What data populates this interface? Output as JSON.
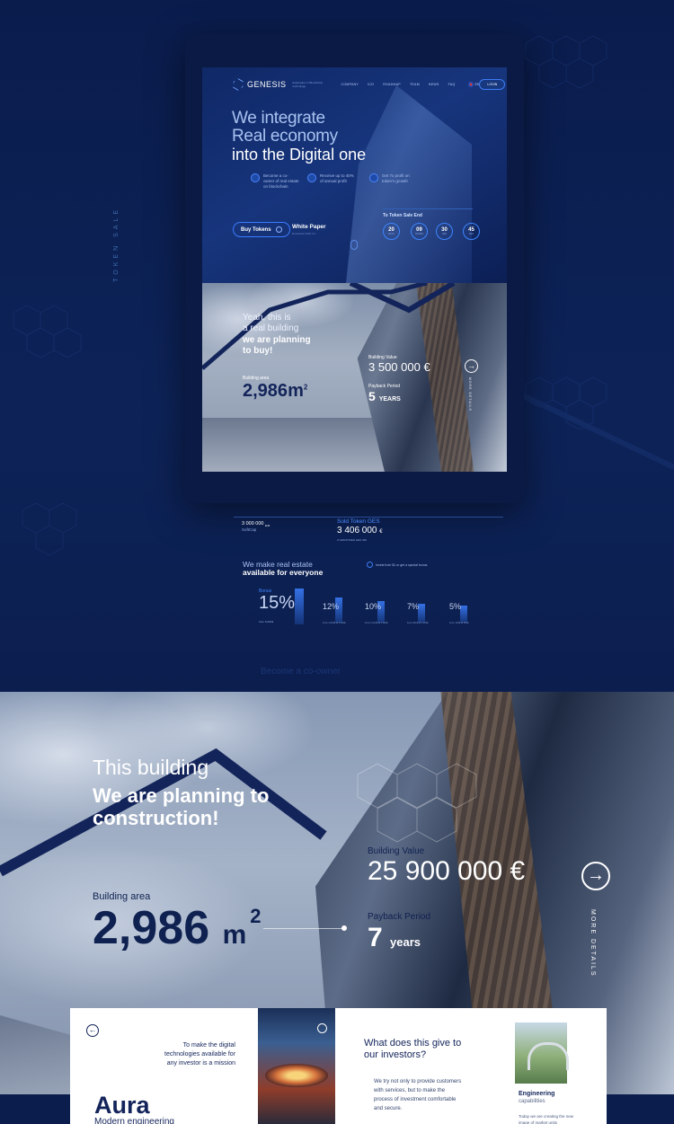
{
  "side_label": "TOKEN SALE",
  "brand": {
    "name": "GENESIS",
    "tagline": "Exploration in Blockchain technology"
  },
  "nav": {
    "items": [
      "COMPANY",
      "ICO",
      "ROADMAP",
      "TEAM",
      "NEWS",
      "FAQ"
    ],
    "lang": "EN",
    "login": "LOGIN"
  },
  "hero": {
    "line1": "We integrate",
    "line2": "Real economy",
    "line3": "into the Digital one",
    "features": [
      {
        "text": "Become a co-owner of real estate on blockchain"
      },
      {
        "text": "Receive up to 40% of annual profit"
      },
      {
        "text": "Get 7x profit on token's growth"
      }
    ],
    "buy_label": "Buy Tokens",
    "white_paper": "White Paper",
    "white_paper_sub": "Download 2018 V.3",
    "token_sale_end": "To Token Sale End",
    "countdown": [
      {
        "value": "20",
        "unit": "DAYS"
      },
      {
        "value": "09",
        "unit": "HOURS"
      },
      {
        "value": "30",
        "unit": "MIN"
      },
      {
        "value": "45",
        "unit": "SEC"
      }
    ]
  },
  "preview_building": {
    "line1": "Yeah, this is",
    "line2": "a real building",
    "line3": "we are planning",
    "line4": "to buy!",
    "area_label": "Building area",
    "area_value": "2,986",
    "area_unit": "m",
    "area_sup": "2",
    "value_label": "Building Value",
    "value": "3 500 000 €",
    "payback_label": "Payback Period",
    "payback_value": "5",
    "payback_unit": "YEARS",
    "more": "MORE DETAILS"
  },
  "sale": {
    "softcap_value": "3 000 000",
    "softcap_unit": "EUR",
    "softcap_label": "SoftCap",
    "sold_label": "Sold Token GES",
    "sold_value": "3 406 000",
    "sold_unit": "€",
    "sold_sub": "2 GES/TOKEN  GES 400",
    "make1": "We make real estate",
    "make2": "available for everyone",
    "invest": "Invest from $1 or get a special bonus",
    "bonus_label": "Bonus",
    "bonus_value": "15%",
    "bonus_from": "from 5,001$",
    "tiers": [
      {
        "pct": "12%",
        "from": "From 2,801$ till 5,000$"
      },
      {
        "pct": "10%",
        "from": "From 2,001$ till 2,800$"
      },
      {
        "pct": "7%",
        "from": "From 801$ till 2,000$"
      },
      {
        "pct": "5%",
        "from": "From 100$ till 800$"
      }
    ],
    "ghost": "Become a co-owner"
  },
  "building": {
    "line1": "This building",
    "line2": "We are planning to",
    "line3": "construction!",
    "value_label": "Building Value",
    "value": "25 900 000 €",
    "area_label": "Building area",
    "area_value": "2,986",
    "area_unit": "m",
    "area_sup": "2",
    "payback_label": "Payback Period",
    "payback_value": "7",
    "payback_unit": "years",
    "more": "MORE DETAILS"
  },
  "cards": {
    "mission": "To make the digital technologies available for any investor is a mission",
    "title": "Aura",
    "subtitle": "Modern engineering",
    "question": "What does this give to our investors?",
    "answer": "We try not only to provide customers with services, but to make the process of investment comfortable and secure.",
    "eng_title": "Engineering",
    "eng_sub": "capabilities",
    "eng_desc": "Today we are creating the new image of market units"
  }
}
